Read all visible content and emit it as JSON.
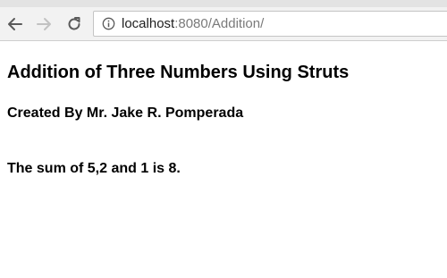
{
  "browser": {
    "url_host": "localhost",
    "url_path": ":8080/Addition/",
    "icons": {
      "back": "arrow-left-icon",
      "forward": "arrow-right-icon",
      "reload": "reload-icon",
      "info": "info-icon"
    }
  },
  "page": {
    "title": "Addition of Three Numbers Using Struts",
    "author": "Created By Mr. Jake R. Pomperada",
    "result": "The sum of 5,2 and 1 is 8."
  }
}
